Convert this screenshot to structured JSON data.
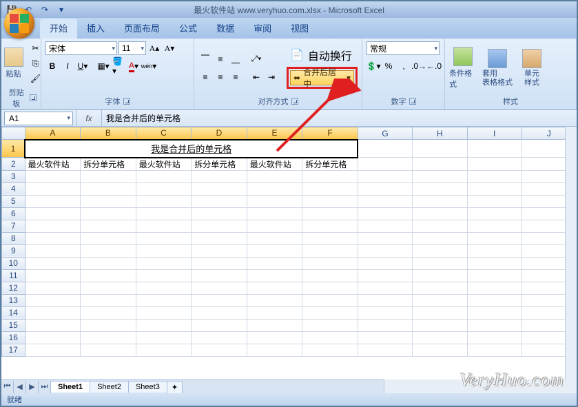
{
  "title": "最火软件站 www.veryhuo.com.xlsx - Microsoft Excel",
  "tabs": [
    "开始",
    "插入",
    "页面布局",
    "公式",
    "数据",
    "审阅",
    "视图"
  ],
  "active_tab": "开始",
  "clipboard": {
    "paste": "粘贴",
    "label": "剪贴板"
  },
  "font": {
    "name": "宋体",
    "size": "11",
    "label": "字体"
  },
  "align": {
    "wrap": "自动换行",
    "merge": "合并后居中",
    "label": "对齐方式"
  },
  "number": {
    "format": "常规",
    "label": "数字"
  },
  "styles": {
    "cond": "条件格式",
    "tablefmt": "套用\n表格格式",
    "cellstyle": "单元\n样式",
    "label": "样式"
  },
  "namebox": "A1",
  "formula": "我是合并后的单元格",
  "columns": [
    "A",
    "B",
    "C",
    "D",
    "E",
    "F",
    "G",
    "H",
    "I",
    "J"
  ],
  "selected_cols": [
    "A",
    "B",
    "C",
    "D",
    "E",
    "F"
  ],
  "merged_text": "我是合并后的单元格",
  "row2": [
    "最火软件站",
    "拆分单元格",
    "最火软件站",
    "拆分单元格",
    "最火软件站",
    "拆分单元格"
  ],
  "rows": 17,
  "sheets": [
    "Sheet1",
    "Sheet2",
    "Sheet3"
  ],
  "active_sheet": "Sheet1",
  "status": "就绪",
  "watermark": "VeryHuo.com"
}
